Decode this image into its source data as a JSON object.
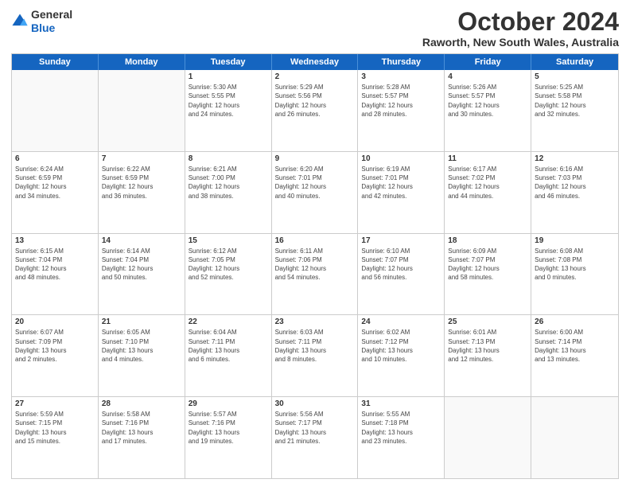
{
  "header": {
    "logo_line1": "General",
    "logo_line2": "Blue",
    "title": "October 2024",
    "subtitle": "Raworth, New South Wales, Australia"
  },
  "weekdays": [
    "Sunday",
    "Monday",
    "Tuesday",
    "Wednesday",
    "Thursday",
    "Friday",
    "Saturday"
  ],
  "weeks": [
    [
      {
        "day": "",
        "info": ""
      },
      {
        "day": "",
        "info": ""
      },
      {
        "day": "1",
        "info": "Sunrise: 5:30 AM\nSunset: 5:55 PM\nDaylight: 12 hours\nand 24 minutes."
      },
      {
        "day": "2",
        "info": "Sunrise: 5:29 AM\nSunset: 5:56 PM\nDaylight: 12 hours\nand 26 minutes."
      },
      {
        "day": "3",
        "info": "Sunrise: 5:28 AM\nSunset: 5:57 PM\nDaylight: 12 hours\nand 28 minutes."
      },
      {
        "day": "4",
        "info": "Sunrise: 5:26 AM\nSunset: 5:57 PM\nDaylight: 12 hours\nand 30 minutes."
      },
      {
        "day": "5",
        "info": "Sunrise: 5:25 AM\nSunset: 5:58 PM\nDaylight: 12 hours\nand 32 minutes."
      }
    ],
    [
      {
        "day": "6",
        "info": "Sunrise: 6:24 AM\nSunset: 6:59 PM\nDaylight: 12 hours\nand 34 minutes."
      },
      {
        "day": "7",
        "info": "Sunrise: 6:22 AM\nSunset: 6:59 PM\nDaylight: 12 hours\nand 36 minutes."
      },
      {
        "day": "8",
        "info": "Sunrise: 6:21 AM\nSunset: 7:00 PM\nDaylight: 12 hours\nand 38 minutes."
      },
      {
        "day": "9",
        "info": "Sunrise: 6:20 AM\nSunset: 7:01 PM\nDaylight: 12 hours\nand 40 minutes."
      },
      {
        "day": "10",
        "info": "Sunrise: 6:19 AM\nSunset: 7:01 PM\nDaylight: 12 hours\nand 42 minutes."
      },
      {
        "day": "11",
        "info": "Sunrise: 6:17 AM\nSunset: 7:02 PM\nDaylight: 12 hours\nand 44 minutes."
      },
      {
        "day": "12",
        "info": "Sunrise: 6:16 AM\nSunset: 7:03 PM\nDaylight: 12 hours\nand 46 minutes."
      }
    ],
    [
      {
        "day": "13",
        "info": "Sunrise: 6:15 AM\nSunset: 7:04 PM\nDaylight: 12 hours\nand 48 minutes."
      },
      {
        "day": "14",
        "info": "Sunrise: 6:14 AM\nSunset: 7:04 PM\nDaylight: 12 hours\nand 50 minutes."
      },
      {
        "day": "15",
        "info": "Sunrise: 6:12 AM\nSunset: 7:05 PM\nDaylight: 12 hours\nand 52 minutes."
      },
      {
        "day": "16",
        "info": "Sunrise: 6:11 AM\nSunset: 7:06 PM\nDaylight: 12 hours\nand 54 minutes."
      },
      {
        "day": "17",
        "info": "Sunrise: 6:10 AM\nSunset: 7:07 PM\nDaylight: 12 hours\nand 56 minutes."
      },
      {
        "day": "18",
        "info": "Sunrise: 6:09 AM\nSunset: 7:07 PM\nDaylight: 12 hours\nand 58 minutes."
      },
      {
        "day": "19",
        "info": "Sunrise: 6:08 AM\nSunset: 7:08 PM\nDaylight: 13 hours\nand 0 minutes."
      }
    ],
    [
      {
        "day": "20",
        "info": "Sunrise: 6:07 AM\nSunset: 7:09 PM\nDaylight: 13 hours\nand 2 minutes."
      },
      {
        "day": "21",
        "info": "Sunrise: 6:05 AM\nSunset: 7:10 PM\nDaylight: 13 hours\nand 4 minutes."
      },
      {
        "day": "22",
        "info": "Sunrise: 6:04 AM\nSunset: 7:11 PM\nDaylight: 13 hours\nand 6 minutes."
      },
      {
        "day": "23",
        "info": "Sunrise: 6:03 AM\nSunset: 7:11 PM\nDaylight: 13 hours\nand 8 minutes."
      },
      {
        "day": "24",
        "info": "Sunrise: 6:02 AM\nSunset: 7:12 PM\nDaylight: 13 hours\nand 10 minutes."
      },
      {
        "day": "25",
        "info": "Sunrise: 6:01 AM\nSunset: 7:13 PM\nDaylight: 13 hours\nand 12 minutes."
      },
      {
        "day": "26",
        "info": "Sunrise: 6:00 AM\nSunset: 7:14 PM\nDaylight: 13 hours\nand 13 minutes."
      }
    ],
    [
      {
        "day": "27",
        "info": "Sunrise: 5:59 AM\nSunset: 7:15 PM\nDaylight: 13 hours\nand 15 minutes."
      },
      {
        "day": "28",
        "info": "Sunrise: 5:58 AM\nSunset: 7:16 PM\nDaylight: 13 hours\nand 17 minutes."
      },
      {
        "day": "29",
        "info": "Sunrise: 5:57 AM\nSunset: 7:16 PM\nDaylight: 13 hours\nand 19 minutes."
      },
      {
        "day": "30",
        "info": "Sunrise: 5:56 AM\nSunset: 7:17 PM\nDaylight: 13 hours\nand 21 minutes."
      },
      {
        "day": "31",
        "info": "Sunrise: 5:55 AM\nSunset: 7:18 PM\nDaylight: 13 hours\nand 23 minutes."
      },
      {
        "day": "",
        "info": ""
      },
      {
        "day": "",
        "info": ""
      }
    ]
  ]
}
